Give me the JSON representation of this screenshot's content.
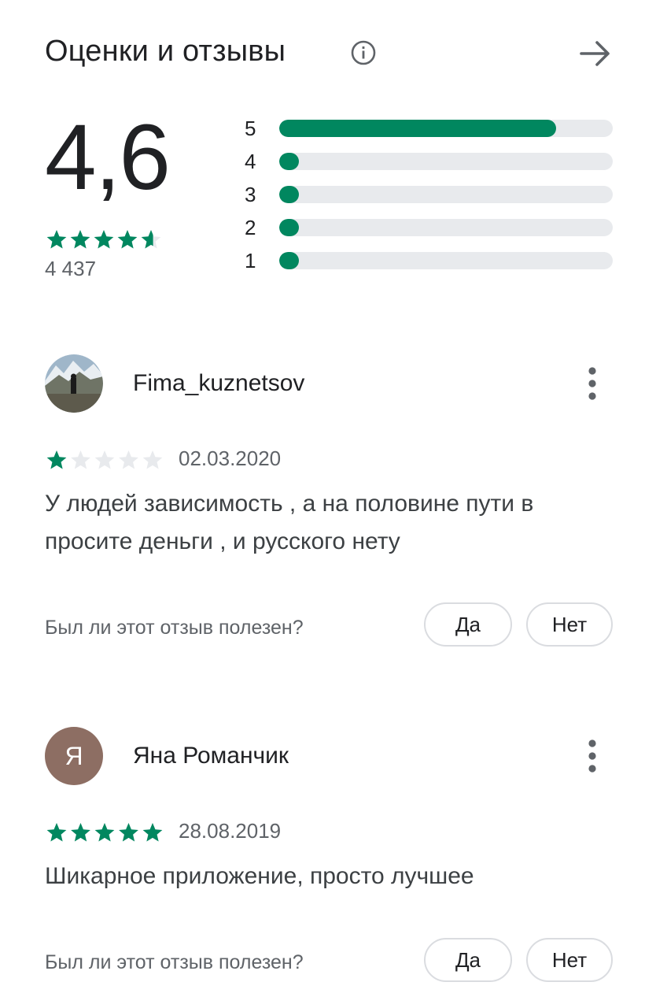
{
  "header": {
    "title": "Оценки и отзывы",
    "info_icon": "info-circle-icon",
    "arrow_icon": "arrow-right-icon"
  },
  "summary": {
    "average": "4,6",
    "average_stars": 4.6,
    "count": "4 437",
    "histogram": [
      {
        "label": "5",
        "fraction": 0.83
      },
      {
        "label": "4",
        "fraction": 0.06
      },
      {
        "label": "3",
        "fraction": 0.06
      },
      {
        "label": "2",
        "fraction": 0.06
      },
      {
        "label": "1",
        "fraction": 0.06
      }
    ]
  },
  "colors": {
    "accent": "#01875f",
    "track": "#e8eaed",
    "star_empty": "#e8eaed",
    "avatar_letter_bg": "#8d6e63"
  },
  "reviews": [
    {
      "author": "Fima_kuznetsov",
      "avatar": "photo-avatar",
      "stars": 1,
      "date": "02.03.2020",
      "text": "У людей зависимость , а на половине пути в просите деньги , и русского нету",
      "helpful_question": "Был ли этот отзыв полезен?",
      "yes_label": "Да",
      "no_label": "Нет"
    },
    {
      "author": "Яна Романчик",
      "avatar_letter": "Я",
      "stars": 5,
      "date": "28.08.2019",
      "text": "Шикарное приложение, просто лучшее",
      "helpful_question": "Был ли этот отзыв полезен?",
      "yes_label": "Да",
      "no_label": "Нет"
    }
  ]
}
